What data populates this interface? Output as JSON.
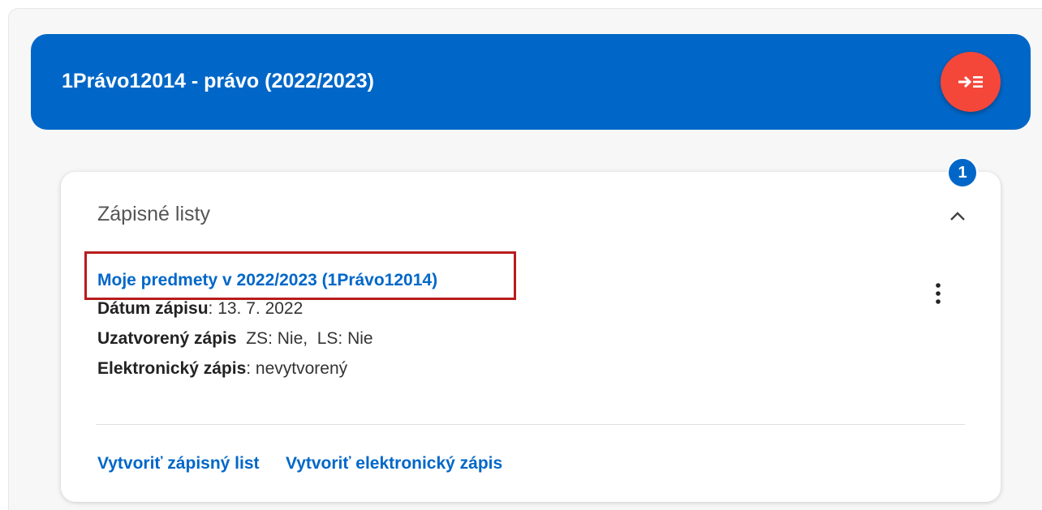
{
  "study": {
    "title": "1Právo12014 - právo (2022/2023)",
    "fab_icon": "arrow-list-icon",
    "header_color": "#0067c8",
    "fab_color": "#f4473a"
  },
  "card": {
    "title": "Zápisné listy",
    "badge_count": "1",
    "collapse_icon": "chevron-up-icon",
    "entry": {
      "link": "Moje predmety v 2022/2023 (1Právo12014)",
      "date_label": "Dátum zápisu",
      "date_value": ": 13. 7. 2022",
      "closed_label": "Uzatvorený zápis",
      "closed_value": "  ZS: Nie,  LS: Nie",
      "electronic_label": "Elektronický zápis",
      "electronic_value": ": nevytvorený",
      "menu_icon": "more-vert-icon"
    },
    "actions": {
      "create_list": "Vytvoriť zápisný list",
      "create_electronic": "Vytvoriť elektronický zápis"
    },
    "highlight_color": "#b71c1c"
  }
}
